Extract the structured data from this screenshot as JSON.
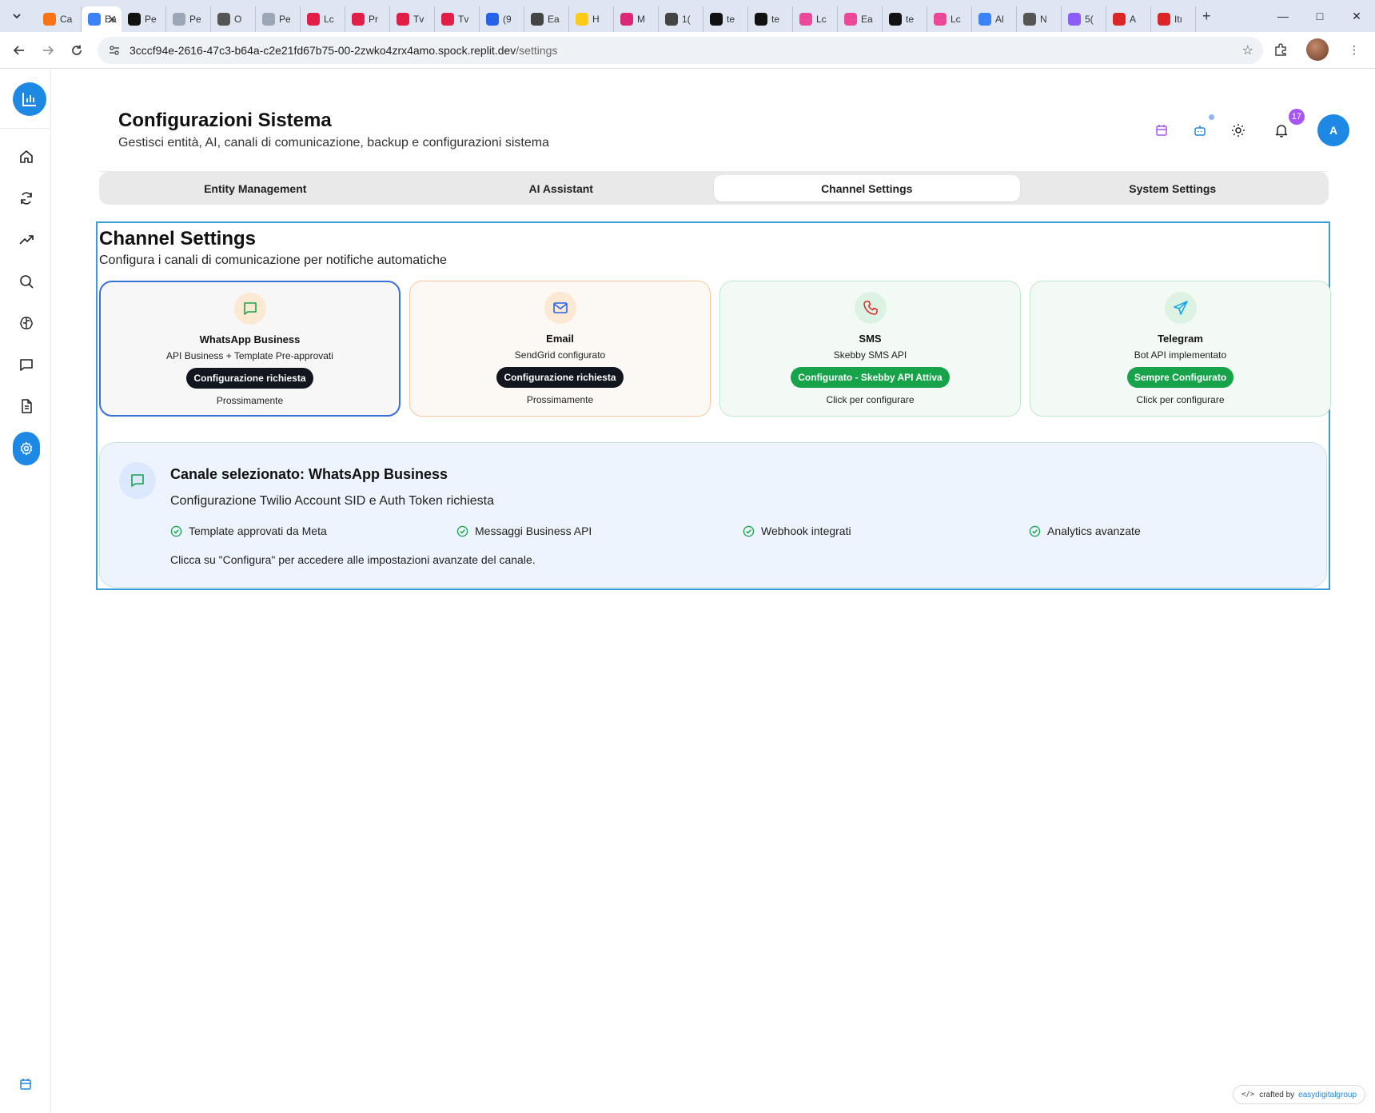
{
  "browser": {
    "tabs": [
      {
        "label": "Ca",
        "color": "#f97316"
      },
      {
        "label": "Ea",
        "color": "#ffffff",
        "active": true
      },
      {
        "label": "Pe",
        "color": "#111111"
      },
      {
        "label": "Pe",
        "color": "#9aa6b8"
      },
      {
        "label": "O",
        "color": "#555555"
      },
      {
        "label": "Pe",
        "color": "#9aa6b8"
      },
      {
        "label": "Lc",
        "color": "#e11d48"
      },
      {
        "label": "Pr",
        "color": "#e11d48"
      },
      {
        "label": "Tv",
        "color": "#e11d48"
      },
      {
        "label": "Tv",
        "color": "#e11d48"
      },
      {
        "label": "(9",
        "color": "#2563eb"
      },
      {
        "label": "Ea",
        "color": "#444444"
      },
      {
        "label": "H",
        "color": "#facc15"
      },
      {
        "label": "M",
        "color": "#db2777"
      },
      {
        "label": "1(",
        "color": "#444444"
      },
      {
        "label": "te",
        "color": "#111111"
      },
      {
        "label": "te",
        "color": "#111111"
      },
      {
        "label": "Lc",
        "color": "#ec4899"
      },
      {
        "label": "Ea",
        "color": "#ec4899"
      },
      {
        "label": "te",
        "color": "#111111"
      },
      {
        "label": "Lc",
        "color": "#ec4899"
      },
      {
        "label": "Al",
        "color": "#3b82f6"
      },
      {
        "label": "N",
        "color": "#555555"
      },
      {
        "label": "5(",
        "color": "#8b5cf6"
      },
      {
        "label": "A",
        "color": "#dc2626"
      },
      {
        "label": "Itı",
        "color": "#dc2626"
      }
    ],
    "url_host": "3cccf94e-2616-47c3-b64a-c2e21fd67b75-00-2zwko4zrx4amo.spock.replit.dev",
    "url_path": "/settings"
  },
  "header": {
    "title": "Configurazioni Sistema",
    "subtitle": "Gestisci entità, AI, canali di comunicazione, backup e configurazioni sistema",
    "notification_count": "17",
    "avatar_initial": "A"
  },
  "tabs": [
    {
      "label": "Entity Management",
      "active": false
    },
    {
      "label": "AI Assistant",
      "active": false
    },
    {
      "label": "Channel Settings",
      "active": true
    },
    {
      "label": "System Settings",
      "active": false
    }
  ],
  "panel": {
    "title": "Channel Settings",
    "subtitle": "Configura i canali di comunicazione per notifiche automatiche"
  },
  "channels": [
    {
      "name": "WhatsApp Business",
      "desc": "API Business + Template Pre-approvati",
      "status": "Configurazione richiesta",
      "footer": "Prossimamente"
    },
    {
      "name": "Email",
      "desc": "SendGrid configurato",
      "status": "Configurazione richiesta",
      "footer": "Prossimamente"
    },
    {
      "name": "SMS",
      "desc": "Skebby SMS API",
      "status": "Configurato - Skebby API Attiva",
      "footer": "Click per configurare"
    },
    {
      "name": "Telegram",
      "desc": "Bot API implementato",
      "status": "Sempre Configurato",
      "footer": "Click per configurare"
    }
  ],
  "selected": {
    "title": "Canale selezionato: WhatsApp Business",
    "desc": "Configurazione Twilio Account SID e Auth Token richiesta",
    "features": [
      "Template approvati da Meta",
      "Messaggi Business API",
      "Webhook integrati",
      "Analytics avanzate"
    ],
    "note": "Clicca su \"Configura\" per accedere alle impostazioni avanzate del canale."
  },
  "footer": {
    "crafted_by": "crafted by",
    "brand": "easydigitalgroup"
  },
  "colors": {
    "primary": "#1e88e5",
    "success": "#16a34a",
    "dark_pill": "#12161f",
    "badge": "#a855f7"
  }
}
